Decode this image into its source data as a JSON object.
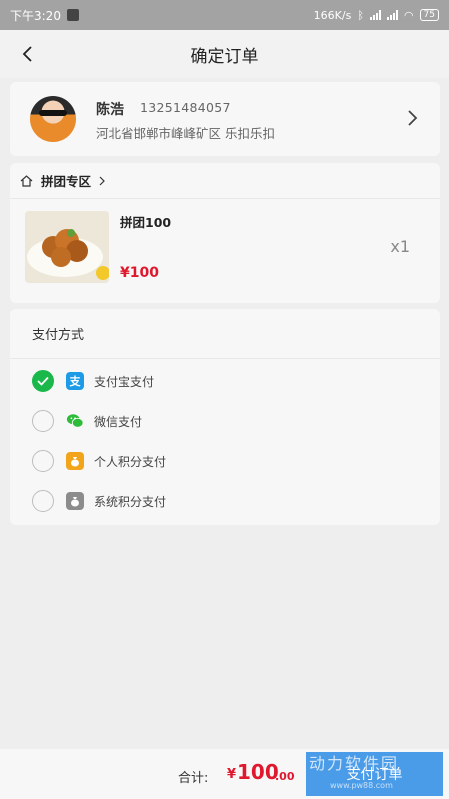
{
  "status_bar": {
    "time": "下午3:20",
    "network_speed": "166K/s",
    "battery": "75"
  },
  "nav": {
    "title": "确定订单"
  },
  "address": {
    "name": "陈浩",
    "phone": "13251484057",
    "detail": "河北省邯郸市峰峰矿区 乐扣乐扣"
  },
  "group": {
    "title": "拼团专区",
    "product": {
      "name": "拼团100",
      "price": "¥100",
      "quantity": "x1"
    }
  },
  "payment": {
    "title": "支付方式",
    "options": [
      {
        "label": "支付宝支付",
        "selected": true,
        "icon": "alipay-icon",
        "icon_color": "#1d9be6"
      },
      {
        "label": "微信支付",
        "selected": false,
        "icon": "wechat-icon",
        "icon_color": "#2dbb3a"
      },
      {
        "label": "个人积分支付",
        "selected": false,
        "icon": "money-bag-icon",
        "icon_color": "#f2a51b"
      },
      {
        "label": "系统积分支付",
        "selected": false,
        "icon": "money-bag-icon",
        "icon_color": "#8c8c8c"
      }
    ]
  },
  "footer": {
    "total_label": "合计:",
    "currency": "¥",
    "total_integer": "100",
    "total_decimal": ".00",
    "pay_button_label": "支付订单"
  },
  "watermark": {
    "text": "动力软件园",
    "url": "www.pw88.com"
  },
  "colors": {
    "accent_red": "#e0182d",
    "pay_button": "#4a9be8",
    "selected_green": "#1ab84b"
  }
}
